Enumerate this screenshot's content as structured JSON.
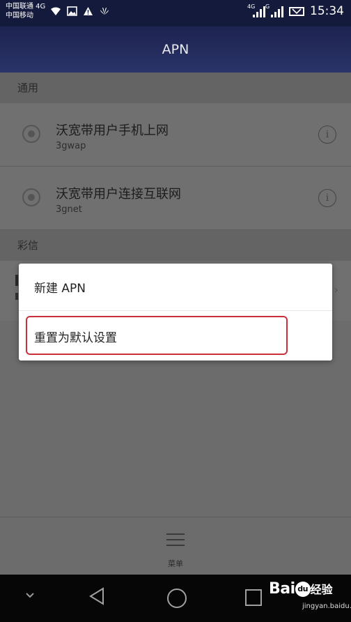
{
  "status_bar": {
    "carrier_1": "中国联通 4G",
    "carrier_2": "中国移动",
    "sim1_network": "4G",
    "sim2_network": "G",
    "time": "15:34"
  },
  "app_bar": {
    "title": "APN"
  },
  "sections": {
    "general": {
      "header": "通用",
      "items": [
        {
          "name": "沃宽带用户手机上网",
          "type": "3gwap"
        },
        {
          "name": "沃宽带用户连接互联网",
          "type": "3gnet"
        }
      ]
    },
    "mms": {
      "header": "彩信"
    }
  },
  "popup_menu": {
    "items": [
      {
        "label": "新建 APN"
      },
      {
        "label": "重置为默认设置"
      }
    ],
    "highlight_color": "#c9303a"
  },
  "bottom_menu": {
    "label": "菜单"
  },
  "watermark": {
    "logo_left": "Bai",
    "logo_mark": "du",
    "logo_cn": "经验",
    "url": "jingyan.baidu.com"
  },
  "colors": {
    "app_bar": "#1d2350",
    "status_bar": "#141a3b",
    "overlay": "#6c6c6c"
  }
}
